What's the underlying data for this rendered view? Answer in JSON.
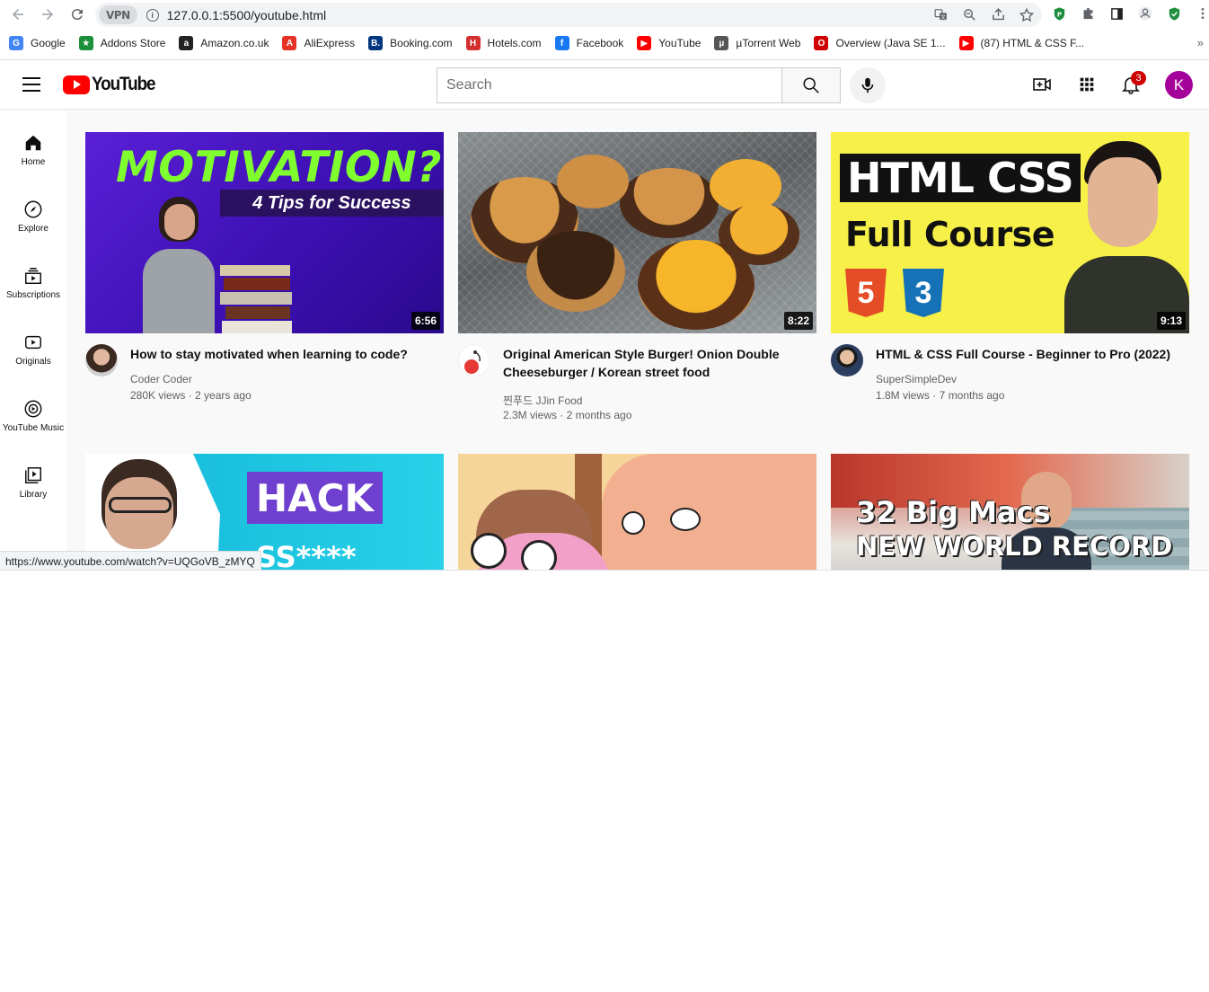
{
  "browser": {
    "url": "127.0.0.1:5500/youtube.html",
    "vpn_label": "VPN",
    "bookmarks": [
      {
        "label": "Google",
        "color": "#4285f4",
        "glyph": "G"
      },
      {
        "label": "Addons Store",
        "color": "#1b8f3a",
        "glyph": "★"
      },
      {
        "label": "Amazon.co.uk",
        "color": "#222222",
        "glyph": "a"
      },
      {
        "label": "AliExpress",
        "color": "#e43225",
        "glyph": "A"
      },
      {
        "label": "Booking.com",
        "color": "#003580",
        "glyph": "B."
      },
      {
        "label": "Hotels.com",
        "color": "#d32f2f",
        "glyph": "H"
      },
      {
        "label": "Facebook",
        "color": "#1877f2",
        "glyph": "f"
      },
      {
        "label": "YouTube",
        "color": "#ff0000",
        "glyph": "▶"
      },
      {
        "label": "µTorrent Web",
        "color": "#555555",
        "glyph": "µ"
      },
      {
        "label": "Overview (Java SE 1...",
        "color": "#d00000",
        "glyph": "O"
      },
      {
        "label": "(87) HTML & CSS F...",
        "color": "#ff0000",
        "glyph": "▶"
      }
    ],
    "more": "»",
    "status_url": "https://www.youtube.com/watch?v=UQGoVB_zMYQ"
  },
  "youtube": {
    "logo_text": "YouTube",
    "search_placeholder": "Search",
    "notification_count": "3",
    "avatar_letter": "K",
    "sidebar": [
      {
        "label": "Home",
        "icon": "home-icon"
      },
      {
        "label": "Explore",
        "icon": "compass-icon"
      },
      {
        "label": "Subscriptions",
        "icon": "subscriptions-icon"
      },
      {
        "label": "Originals",
        "icon": "originals-icon"
      },
      {
        "label": "YouTube Music",
        "icon": "music-icon"
      },
      {
        "label": "Library",
        "icon": "library-icon"
      }
    ],
    "videos": [
      {
        "title": "How to stay motivated when learning to code?",
        "channel": "Coder Coder",
        "stats": "280K views · 2 years ago",
        "duration": "6:56",
        "thumb_text_1": "MOTIVATION?",
        "thumb_text_2": "4 Tips for Success"
      },
      {
        "title": "Original American Style Burger! Onion Double Cheeseburger / Korean street food",
        "channel": "찐푸드 JJin Food",
        "stats": "2.3M views · 2 months ago",
        "duration": "8:22"
      },
      {
        "title": "HTML & CSS Full Course - Beginner to Pro (2022)",
        "channel": "SuperSimpleDev",
        "stats": "1.8M views · 7 months ago",
        "duration": "9:13",
        "thumb_text_1": "HTML CSS",
        "thumb_text_2": "Full Course"
      },
      {
        "thumb_text_1": "HACK",
        "thumb_text_2": "SS****"
      },
      {},
      {
        "thumb_text_1": "32 Big Macs",
        "thumb_text_2": "NEW WORLD RECORD"
      }
    ]
  }
}
